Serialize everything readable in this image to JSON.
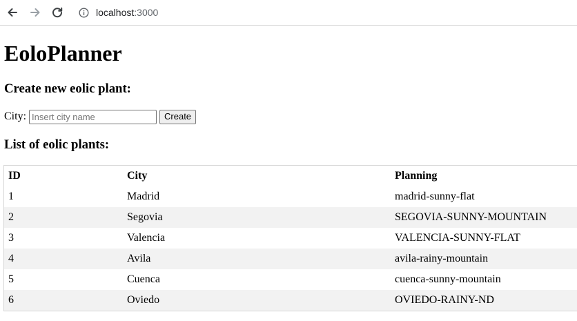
{
  "browser": {
    "url_host": "localhost",
    "url_port": ":3000"
  },
  "page": {
    "title": "EoloPlanner",
    "create_heading": "Create new eolic plant:",
    "form": {
      "city_label": "City:",
      "city_placeholder": "Insert city name",
      "city_value": "",
      "create_button": "Create"
    },
    "list_heading": "List of eolic plants:",
    "table": {
      "headers": [
        "ID",
        "City",
        "Planning"
      ],
      "rows": [
        [
          "1",
          "Madrid",
          "madrid-sunny-flat"
        ],
        [
          "2",
          "Segovia",
          "SEGOVIA-SUNNY-MOUNTAIN"
        ],
        [
          "3",
          "Valencia",
          "VALENCIA-SUNNY-FLAT"
        ],
        [
          "4",
          "Avila",
          "avila-rainy-mountain"
        ],
        [
          "5",
          "Cuenca",
          "cuenca-sunny-mountain"
        ],
        [
          "6",
          "Oviedo",
          "OVIEDO-RAINY-ND"
        ]
      ]
    }
  },
  "colors": {
    "row_stripe": "#f2f2f2",
    "border": "#d6d6d6"
  },
  "icons": {
    "back": "arrow-left-icon",
    "forward": "arrow-right-icon",
    "reload": "reload-icon",
    "site_info": "info-icon"
  }
}
